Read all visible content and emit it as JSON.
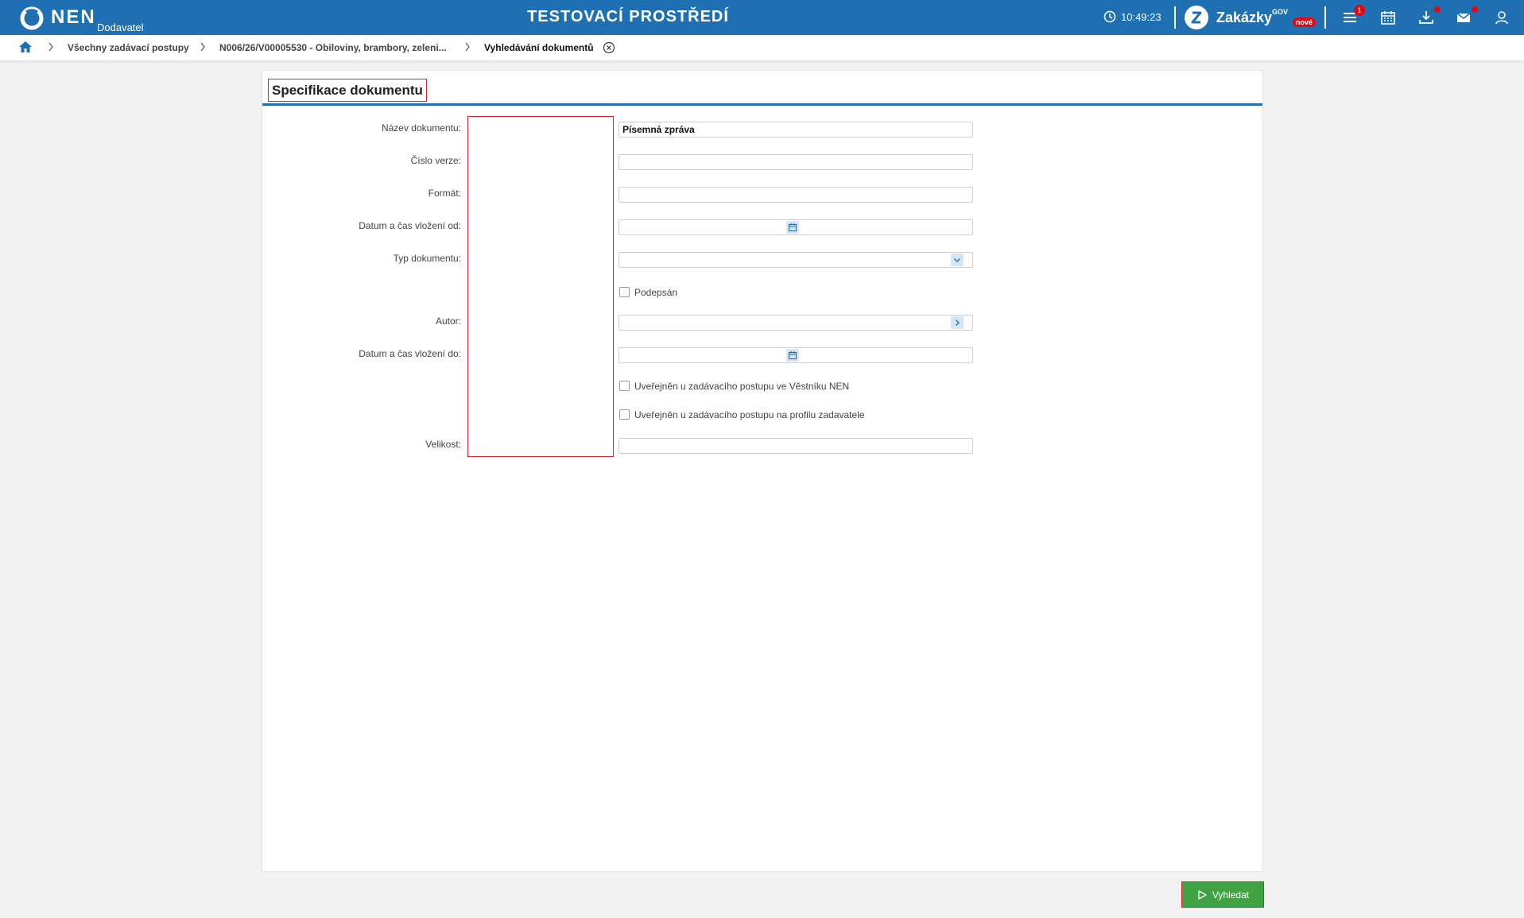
{
  "header": {
    "logo_text": "NEN",
    "role": "Dodavatel",
    "environment_title": "TESTOVACÍ PROSTŘEDÍ",
    "clock": "10:49:23",
    "zakazky_label": "Zakázky",
    "zakazky_gov": "GOV",
    "zakazky_badge": "nové",
    "menu_badge_count": "1",
    "icons": [
      "clock-icon",
      "menu-icon",
      "calendar-icon",
      "download-icon",
      "mail-icon",
      "user-icon"
    ],
    "color_primary": "#1f70b3",
    "color_badge": "#e30613"
  },
  "breadcrumb": {
    "items": [
      "Všechny zadávací postupy",
      "N006/26/V00005530 - Obiloviny, brambory, zeleni...",
      "Vyhledávání dokumentů"
    ]
  },
  "panel": {
    "title": "Specifikace dokumentu"
  },
  "form": {
    "nazev_label": "Název dokumentu:",
    "nazev_value": "Písemná zpráva",
    "cislo_verze_label": "Číslo verze:",
    "cislo_verze_value": "",
    "format_label": "Formát:",
    "format_value": "",
    "datum_od_label": "Datum a čas vložení od:",
    "datum_od_value": "",
    "typ_label": "Typ dokumentu:",
    "typ_value": "",
    "podepsan_label": "Podepsán",
    "autor_label": "Autor:",
    "autor_value": "",
    "datum_do_label": "Datum a čas vložení do:",
    "datum_do_value": "",
    "vestnik_label": "Uveřejněn u zadávacího postupu ve Věstníku NEN",
    "profil_label": "Uveřejněn u zadávacího postupu na profilu zadavatele",
    "velikost_label": "Velikost:",
    "velikost_value": ""
  },
  "actions": {
    "search_label": "Vyhledat",
    "search_color": "#3fa343"
  }
}
